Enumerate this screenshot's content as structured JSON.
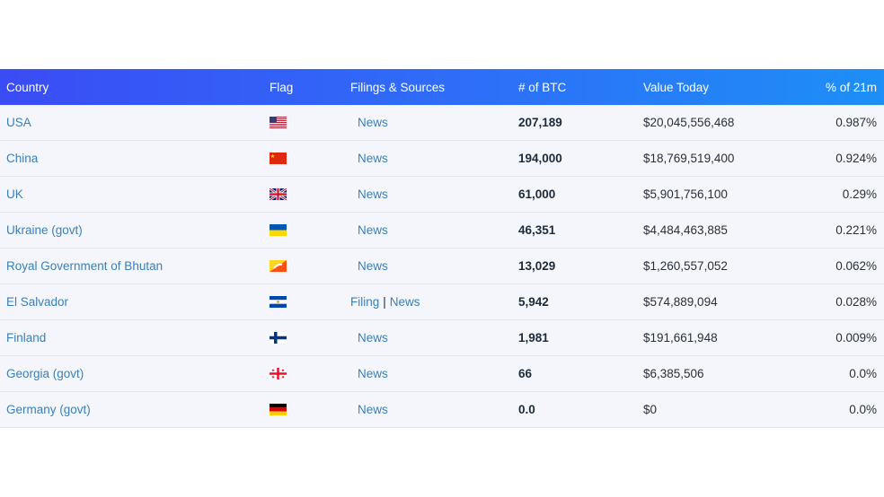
{
  "table": {
    "headers": {
      "country": "Country",
      "flag": "Flag",
      "filings": "Filings & Sources",
      "btc": "# of BTC",
      "value": "Value Today",
      "pct": "% of 21m"
    },
    "rows": [
      {
        "country": "USA",
        "flag_icon": "usa-flag-icon",
        "filing": "",
        "sep": "",
        "news": "News",
        "btc": "207,189",
        "value": "$20,045,556,468",
        "pct": "0.987%"
      },
      {
        "country": "China",
        "flag_icon": "china-flag-icon",
        "filing": "",
        "sep": "",
        "news": "News",
        "btc": "194,000",
        "value": "$18,769,519,400",
        "pct": "0.924%"
      },
      {
        "country": "UK",
        "flag_icon": "uk-flag-icon",
        "filing": "",
        "sep": "",
        "news": "News",
        "btc": "61,000",
        "value": "$5,901,756,100",
        "pct": "0.29%"
      },
      {
        "country": "Ukraine (govt)",
        "flag_icon": "ukraine-flag-icon",
        "filing": "",
        "sep": "",
        "news": "News",
        "btc": "46,351",
        "value": "$4,484,463,885",
        "pct": "0.221%"
      },
      {
        "country": "Royal Government of Bhutan",
        "flag_icon": "bhutan-flag-icon",
        "filing": "",
        "sep": "",
        "news": "News",
        "btc": "13,029",
        "value": "$1,260,557,052",
        "pct": "0.062%"
      },
      {
        "country": "El Salvador",
        "flag_icon": "el-salvador-flag-icon",
        "filing": "Filing",
        "sep": "|",
        "news": "News",
        "btc": "5,942",
        "value": "$574,889,094",
        "pct": "0.028%"
      },
      {
        "country": "Finland",
        "flag_icon": "finland-flag-icon",
        "filing": "",
        "sep": "",
        "news": "News",
        "btc": "1,981",
        "value": "$191,661,948",
        "pct": "0.009%"
      },
      {
        "country": "Georgia (govt)",
        "flag_icon": "georgia-flag-icon",
        "filing": "",
        "sep": "",
        "news": "News",
        "btc": "66",
        "value": "$6,385,506",
        "pct": "0.0%"
      },
      {
        "country": "Germany (govt)",
        "flag_icon": "germany-flag-icon",
        "filing": "",
        "sep": "",
        "news": "News",
        "btc": "0.0",
        "value": "$0",
        "pct": "0.0%"
      }
    ]
  },
  "colors": {
    "header_start": "#3a4cf5",
    "header_end": "#1d8ff7",
    "link": "#3a7fb7",
    "row_bg": "#f4f6fb"
  }
}
